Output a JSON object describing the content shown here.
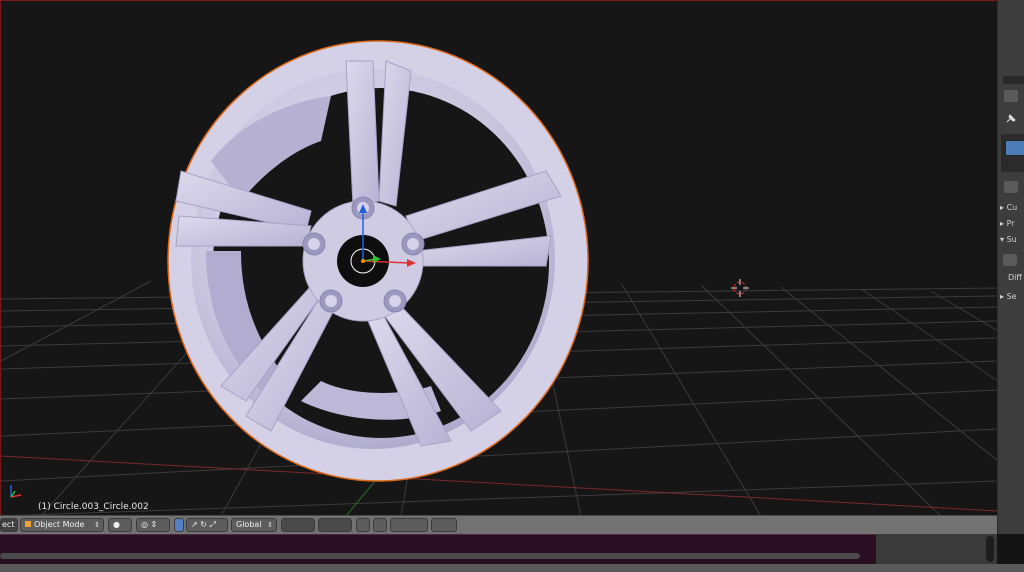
{
  "viewport": {
    "object_label": "(1) Circle.003_Circle.002"
  },
  "header": {
    "menu_partial": "ect",
    "mode_label": "Object Mode",
    "orientation_label": "Global"
  },
  "right_panel": {
    "items": [
      {
        "label": "Cu"
      },
      {
        "label": "Pr"
      },
      {
        "label": "Su"
      },
      {
        "label": "Diff"
      },
      {
        "label": "Se"
      }
    ]
  },
  "colors": {
    "viewport_bg": "#161616",
    "selection_outline": "#e06a1a",
    "axis_x": "#e03030",
    "axis_y": "#30c030",
    "axis_z": "#2060e0",
    "wheel": "#c8c4de",
    "timeline_bg": "#2a0f22"
  },
  "icons": [
    "3d-cursor-icon",
    "transform-gizmo-icon",
    "axis-widget-icon",
    "viewport-shade-icon",
    "pivot-icon",
    "manipulator-icon",
    "layer-grid-icon",
    "lock-icon",
    "snap-icon",
    "render-icon"
  ]
}
